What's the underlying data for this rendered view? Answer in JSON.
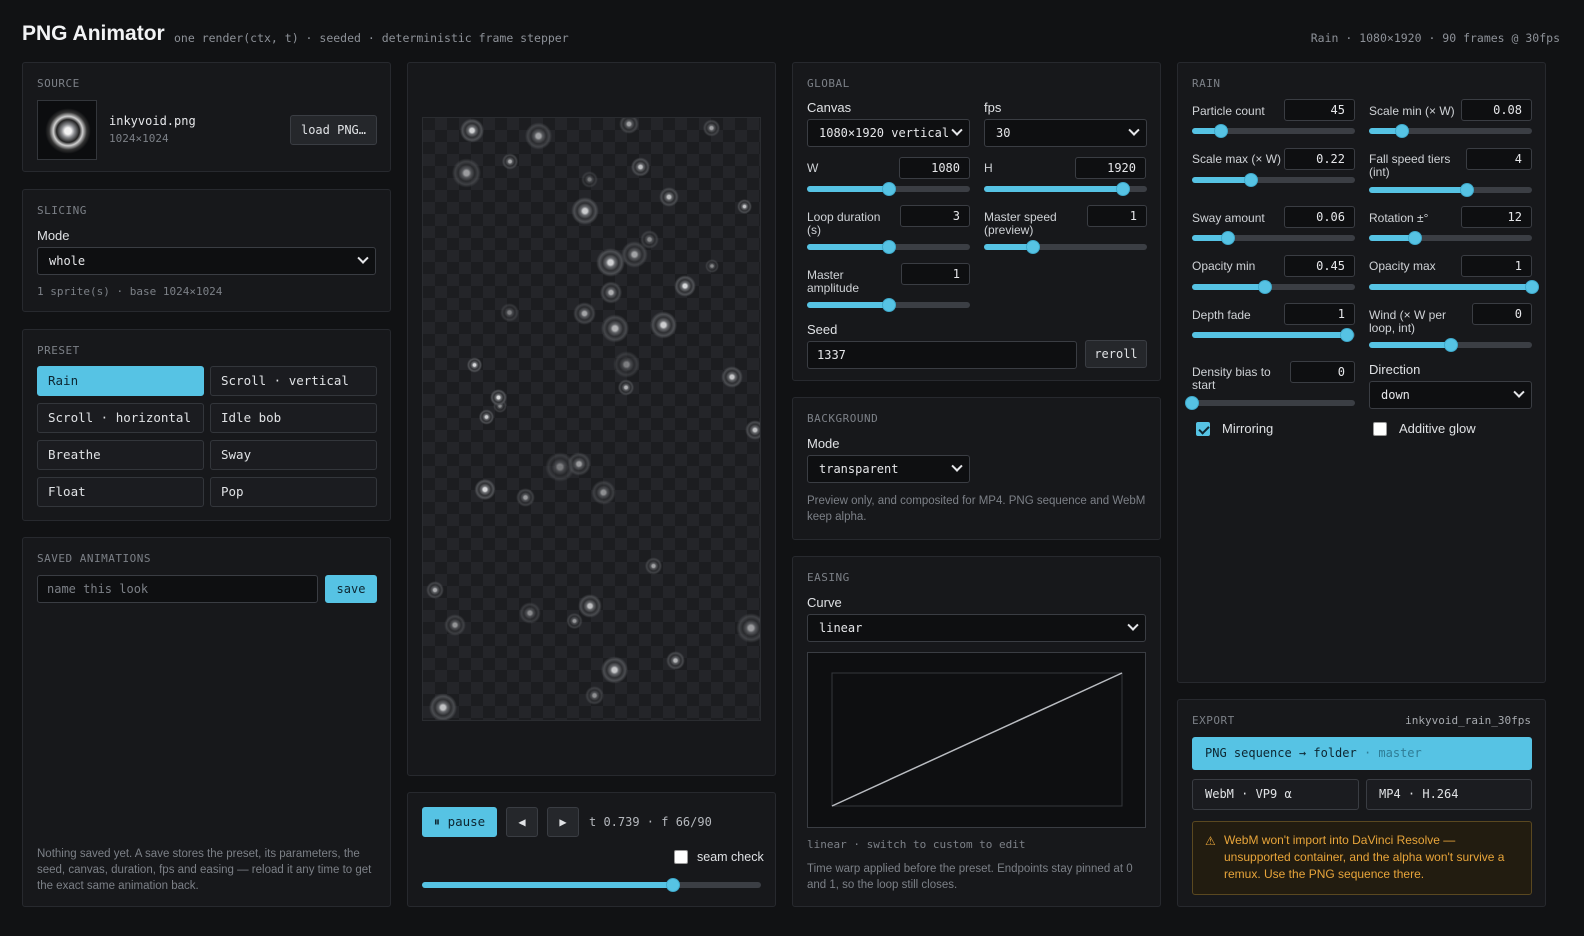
{
  "header": {
    "title": "PNG Animator",
    "subtitle": "one render(ctx, t) · seeded · deterministic frame stepper",
    "status": "Rain · 1080×1920 · 90 frames @ 30fps"
  },
  "source": {
    "title": "SOURCE",
    "filename": "inkyvoid.png",
    "dims": "1024×1024",
    "load_label": "load PNG…"
  },
  "slicing": {
    "title": "SLICING",
    "mode_label": "Mode",
    "mode_value": "whole",
    "info": "1 sprite(s) · base 1024×1024"
  },
  "preset": {
    "title": "PRESET",
    "items": [
      "Rain",
      "Scroll · vertical",
      "Scroll · horizontal",
      "Idle bob",
      "Breathe",
      "Sway",
      "Float",
      "Pop"
    ],
    "active": "Rain"
  },
  "saved": {
    "title": "SAVED ANIMATIONS",
    "placeholder": "name this look",
    "save_label": "save",
    "note": "Nothing saved yet. A save stores the preset, its parameters, the seed, canvas, duration, fps and easing — reload it any time to get the exact same animation back."
  },
  "playback": {
    "pause_label": "⏸ pause",
    "prev_icon": "◀",
    "next_icon": "▶",
    "time_readout": "t 0.739 · f 66/90",
    "seam_label": "seam check",
    "progress": 0.739
  },
  "global": {
    "title": "GLOBAL",
    "canvas_label": "Canvas",
    "canvas_value": "1080×1920 vertical",
    "fps_label": "fps",
    "fps_value": "30",
    "w_label": "W",
    "w_value": "1080",
    "w_level": 0.5,
    "h_label": "H",
    "h_value": "1920",
    "h_level": 0.85,
    "loop_label": "Loop duration (s)",
    "loop_value": "3",
    "loop_level": 0.5,
    "speed_label": "Master speed (preview)",
    "speed_value": "1",
    "speed_level": 0.3,
    "amp_label": "Master amplitude",
    "amp_value": "1",
    "amp_level": 0.5,
    "seed_label": "Seed",
    "seed_value": "1337",
    "reroll_label": "reroll"
  },
  "background": {
    "title": "BACKGROUND",
    "mode_label": "Mode",
    "mode_value": "transparent",
    "note": "Preview only, and composited for MP4. PNG sequence and WebM keep alpha."
  },
  "easing": {
    "title": "EASING",
    "curve_label": "Curve",
    "curve_value": "linear",
    "caption": "linear · switch to custom to edit",
    "note": "Time warp applied before the preset. Endpoints stay pinned at 0 and 1, so the loop still closes."
  },
  "rain": {
    "title": "RAIN",
    "particle_count": {
      "label": "Particle count",
      "value": "45",
      "level": 0.18
    },
    "scale_min": {
      "label": "Scale min (× W)",
      "value": "0.08",
      "level": 0.2
    },
    "scale_max": {
      "label": "Scale max (× W)",
      "value": "0.22",
      "level": 0.36
    },
    "fall_tiers": {
      "label": "Fall speed tiers (int)",
      "value": "4",
      "level": 0.6
    },
    "sway": {
      "label": "Sway amount",
      "value": "0.06",
      "level": 0.22
    },
    "rotation": {
      "label": "Rotation ±°",
      "value": "12",
      "level": 0.28
    },
    "opacity_min": {
      "label": "Opacity min",
      "value": "0.45",
      "level": 0.45
    },
    "opacity_max": {
      "label": "Opacity max",
      "value": "1",
      "level": 1.0
    },
    "depth_fade": {
      "label": "Depth fade",
      "value": "1",
      "level": 0.95
    },
    "wind": {
      "label": "Wind (× W per loop, int)",
      "value": "0",
      "level": 0.5
    },
    "density": {
      "label": "Density bias to start",
      "value": "0",
      "level": 0.0
    },
    "direction_label": "Direction",
    "direction_value": "down",
    "mirroring_label": "Mirroring",
    "mirroring": true,
    "glow_label": "Additive glow",
    "glow": false
  },
  "export": {
    "title": "EXPORT",
    "filename": "inkyvoid_rain_30fps",
    "png_label": "PNG sequence → folder",
    "png_tag": "· master",
    "webm_label": "WebM · VP9 α",
    "mp4_label": "MP4 · H.264",
    "warning_icon": "⚠",
    "warning": "WebM won't import into DaVinci Resolve — unsupported container, and the alpha won't survive a remux. Use the PNG sequence there."
  },
  "colors": {
    "accent": "#56c3e4",
    "warning": "#e8a53a"
  }
}
